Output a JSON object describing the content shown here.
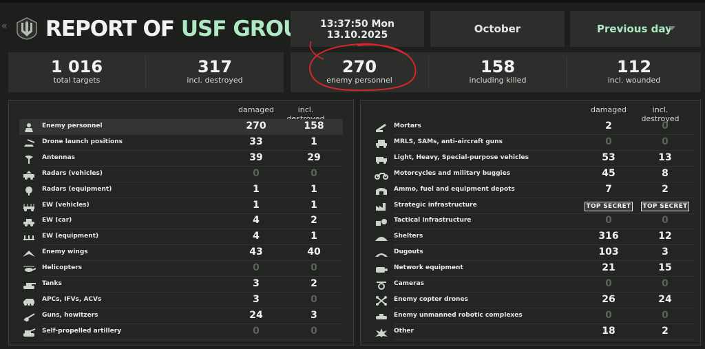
{
  "header": {
    "title_white": "REPORT OF ",
    "title_green": "USF GROUPING",
    "time_line": "13:37:50 Mon",
    "date_line": "13.10.2025",
    "month": "October",
    "period_select": "Previous day"
  },
  "stats": [
    {
      "value": "1 016",
      "label": "total targets"
    },
    {
      "value": "317",
      "label": "incl. destroyed"
    },
    {
      "value": "270",
      "label": "enemy personnel"
    },
    {
      "value": "158",
      "label": "including killed"
    },
    {
      "value": "112",
      "label": "incl. wounded"
    }
  ],
  "columns": {
    "damaged": "damaged",
    "destroyed": "incl. destroyed"
  },
  "left_table": [
    {
      "icon": "soldier-icon",
      "name": "Enemy personnel",
      "damaged": "270",
      "destroyed": "158"
    },
    {
      "icon": "drone-launch-icon",
      "name": "Drone launch positions",
      "damaged": "33",
      "destroyed": "1"
    },
    {
      "icon": "antenna-icon",
      "name": "Antennas",
      "damaged": "39",
      "destroyed": "29"
    },
    {
      "icon": "radar-vehicle-icon",
      "name": "Radars (vehicles)",
      "damaged": "0",
      "destroyed": "0"
    },
    {
      "icon": "radar-equipment-icon",
      "name": "Radars (equipment)",
      "damaged": "1",
      "destroyed": "1"
    },
    {
      "icon": "ew-vehicle-icon",
      "name": "EW (vehicles)",
      "damaged": "1",
      "destroyed": "1"
    },
    {
      "icon": "ew-car-icon",
      "name": "EW (car)",
      "damaged": "4",
      "destroyed": "2"
    },
    {
      "icon": "ew-equipment-icon",
      "name": "EW (equipment)",
      "damaged": "4",
      "destroyed": "1"
    },
    {
      "icon": "wings-icon",
      "name": "Enemy wings",
      "damaged": "43",
      "destroyed": "40"
    },
    {
      "icon": "helicopter-icon",
      "name": "Helicopters",
      "damaged": "0",
      "destroyed": "0"
    },
    {
      "icon": "tank-icon",
      "name": "Tanks",
      "damaged": "3",
      "destroyed": "2"
    },
    {
      "icon": "apc-icon",
      "name": "APCs, IFVs, ACVs",
      "damaged": "3",
      "destroyed": "0"
    },
    {
      "icon": "howitzer-icon",
      "name": "Guns, howitzers",
      "damaged": "24",
      "destroyed": "3"
    },
    {
      "icon": "sp-artillery-icon",
      "name": "Self-propelled artillery",
      "damaged": "0",
      "destroyed": "0"
    }
  ],
  "right_table": [
    {
      "icon": "mortar-icon",
      "name": "Mortars",
      "damaged": "2",
      "destroyed": "0"
    },
    {
      "icon": "mlrs-icon",
      "name": "MRLS, SAMs, anti-aircraft guns",
      "damaged": "0",
      "destroyed": "0"
    },
    {
      "icon": "truck-icon",
      "name": "Light, Heavy, Special-purpose vehicles",
      "damaged": "53",
      "destroyed": "13"
    },
    {
      "icon": "motorcycle-icon",
      "name": "Motorcycles and military buggies",
      "damaged": "45",
      "destroyed": "8"
    },
    {
      "icon": "depot-icon",
      "name": "Ammo, fuel and equipment depots",
      "damaged": "7",
      "destroyed": "2"
    },
    {
      "icon": "factory-icon",
      "name": "Strategic infrastructure",
      "damaged": "TOP SECRET",
      "destroyed": "TOP SECRET"
    },
    {
      "icon": "tactical-icon",
      "name": "Tactical infrastructure",
      "damaged": "0",
      "destroyed": "0"
    },
    {
      "icon": "shelter-icon",
      "name": "Shelters",
      "damaged": "316",
      "destroyed": "12"
    },
    {
      "icon": "dugout-icon",
      "name": "Dugouts",
      "damaged": "103",
      "destroyed": "3"
    },
    {
      "icon": "network-icon",
      "name": "Network equipment",
      "damaged": "21",
      "destroyed": "15"
    },
    {
      "icon": "camera-icon",
      "name": "Cameras",
      "damaged": "0",
      "destroyed": "0"
    },
    {
      "icon": "copter-drone-icon",
      "name": "Enemy copter drones",
      "damaged": "26",
      "destroyed": "24"
    },
    {
      "icon": "robotic-complex-icon",
      "name": "Enemy unmanned robotic complexes",
      "damaged": "0",
      "destroyed": "0"
    },
    {
      "icon": "explosion-icon",
      "name": "Other",
      "damaged": "18",
      "destroyed": "2"
    }
  ],
  "colors": {
    "accent": "#aee9c3",
    "background": "#1d1f1c",
    "card": "#2b2e2a",
    "annotation": "#d4262c"
  }
}
